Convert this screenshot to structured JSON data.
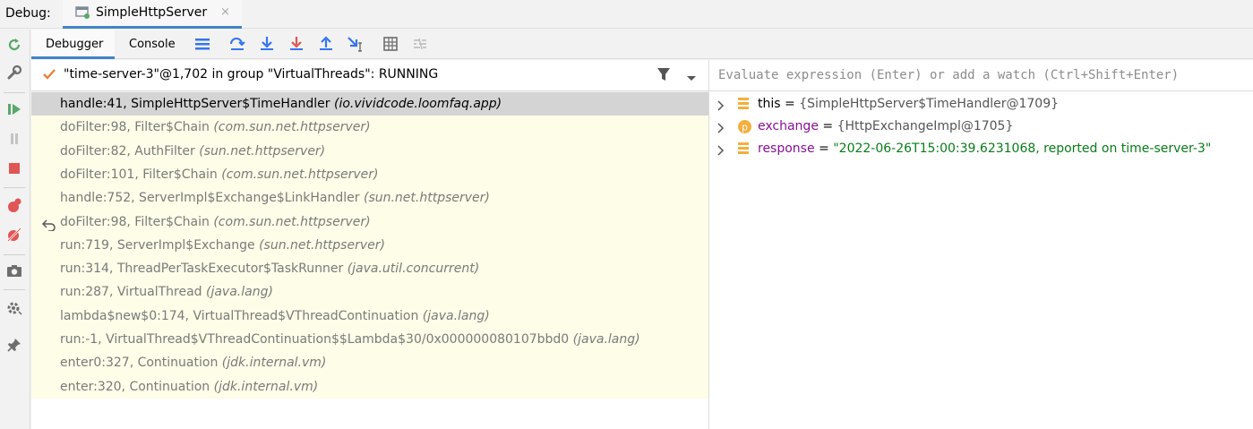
{
  "titlebar": {
    "debug_label": "Debug:",
    "session_tab": "SimpleHttpServer",
    "close_glyph": "×"
  },
  "toolbar": {
    "tabs": [
      "Debugger",
      "Console"
    ],
    "icons": [
      "layout-icon",
      "step-over-icon",
      "step-into-icon",
      "force-step-into-icon",
      "step-out-icon",
      "run-to-cursor-icon",
      "evaluate-expression-icon",
      "trace-icon"
    ]
  },
  "thread": {
    "label": "\"time-server-3\"@1,702 in group \"VirtualThreads\": RUNNING"
  },
  "frames": [
    {
      "method": "handle:41, SimpleHttpServer$TimeHandler",
      "pkg": "(io.vividcode.loomfaq.app)",
      "selected": true
    },
    {
      "method": "doFilter:98, Filter$Chain",
      "pkg": "(com.sun.net.httpserver)"
    },
    {
      "method": "doFilter:82, AuthFilter",
      "pkg": "(sun.net.httpserver)"
    },
    {
      "method": "doFilter:101, Filter$Chain",
      "pkg": "(com.sun.net.httpserver)"
    },
    {
      "method": "handle:752, ServerImpl$Exchange$LinkHandler",
      "pkg": "(sun.net.httpserver)"
    },
    {
      "method": "doFilter:98, Filter$Chain",
      "pkg": "(com.sun.net.httpserver)",
      "drop_icon": true
    },
    {
      "method": "run:719, ServerImpl$Exchange",
      "pkg": "(sun.net.httpserver)"
    },
    {
      "method": "run:314, ThreadPerTaskExecutor$TaskRunner",
      "pkg": "(java.util.concurrent)"
    },
    {
      "method": "run:287, VirtualThread",
      "pkg": "(java.lang)"
    },
    {
      "method": "lambda$new$0:174, VirtualThread$VThreadContinuation",
      "pkg": "(java.lang)"
    },
    {
      "method": "run:-1, VirtualThread$VThreadContinuation$$Lambda$30/0x000000080107bbd0",
      "pkg": "(java.lang)"
    },
    {
      "method": "enter0:327, Continuation",
      "pkg": "(jdk.internal.vm)"
    },
    {
      "method": "enter:320, Continuation",
      "pkg": "(jdk.internal.vm)"
    }
  ],
  "evaluate": {
    "placeholder": "Evaluate expression (Enter) or add a watch (Ctrl+Shift+Enter)"
  },
  "variables": [
    {
      "name": "this",
      "eq": " = ",
      "value": "{SimpleHttpServer$TimeHandler@1709}",
      "kind": "field"
    },
    {
      "name": "exchange",
      "eq": " = ",
      "value": "{HttpExchangeImpl@1705}",
      "kind": "param"
    },
    {
      "name": "response",
      "eq": " = ",
      "value": "\"2022-06-26T15:00:39.6231068, reported on time-server-3\"",
      "kind": "field"
    }
  ],
  "colors": {
    "accent": "#4083c9",
    "frames_bg": "#fdfde8",
    "selected_row": "#d4d4d4",
    "string_value": "#067d17"
  }
}
